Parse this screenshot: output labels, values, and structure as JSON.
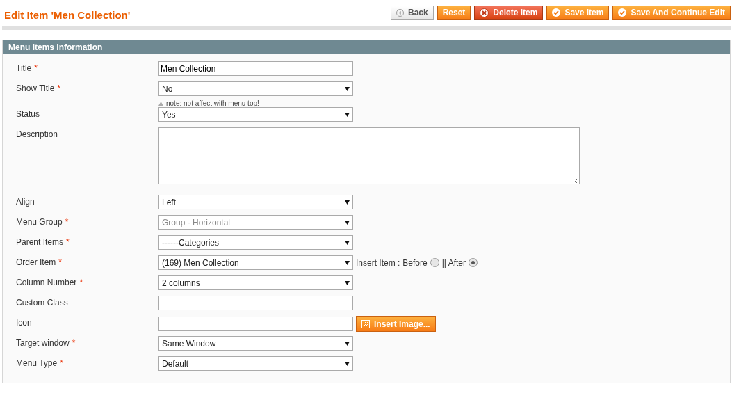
{
  "page_title": "Edit Item 'Men Collection'",
  "buttons": [
    {
      "label": "Back",
      "kind": "back"
    },
    {
      "label": "Reset",
      "kind": "plain"
    },
    {
      "label": "Delete Item",
      "kind": "delete"
    },
    {
      "label": "Save Item",
      "kind": "save"
    },
    {
      "label": "Save And Continue Edit",
      "kind": "save"
    }
  ],
  "section": {
    "title": "Menu Items information",
    "fields": [
      {
        "label": "Title",
        "required_mark": "*",
        "kind": "text",
        "value": "Men Collection"
      },
      {
        "label": "Show Title",
        "required_mark": "*",
        "kind": "select",
        "value": "No",
        "disabled": false,
        "note": "note: not affect with menu top!"
      },
      {
        "label": "Status",
        "kind": "select",
        "value": "Yes",
        "disabled": false
      },
      {
        "label": "Description",
        "kind": "textarea"
      },
      {
        "label": "Align",
        "kind": "select",
        "value": "Left",
        "disabled": false
      },
      {
        "label": "Menu Group",
        "required_mark": "*",
        "kind": "select",
        "value": "Group - Horizontal",
        "disabled": true
      },
      {
        "label": "Parent Items",
        "required_mark": "*",
        "kind": "select",
        "value": "------Categories",
        "disabled": false
      },
      {
        "label": "Order Item",
        "required_mark": "*",
        "kind": "select",
        "value": "(169) Men Collection",
        "disabled": false,
        "insert": {
          "prefix": "Insert Item :",
          "options": [
            {
              "label": "Before",
              "selected": false
            },
            {
              "label": "|| After",
              "selected": true
            }
          ]
        }
      },
      {
        "label": "Column Number",
        "required_mark": "*",
        "kind": "select",
        "value": "2 columns",
        "disabled": false
      },
      {
        "label": "Custom Class",
        "kind": "text"
      },
      {
        "label": "Icon",
        "kind": "text",
        "button": "Insert Image..."
      },
      {
        "label": "Target window",
        "required_mark": "*",
        "kind": "select",
        "value": "Same Window",
        "disabled": false
      },
      {
        "label": "Menu Type",
        "required_mark": "*",
        "kind": "select",
        "value": "Default",
        "disabled": false
      }
    ]
  }
}
